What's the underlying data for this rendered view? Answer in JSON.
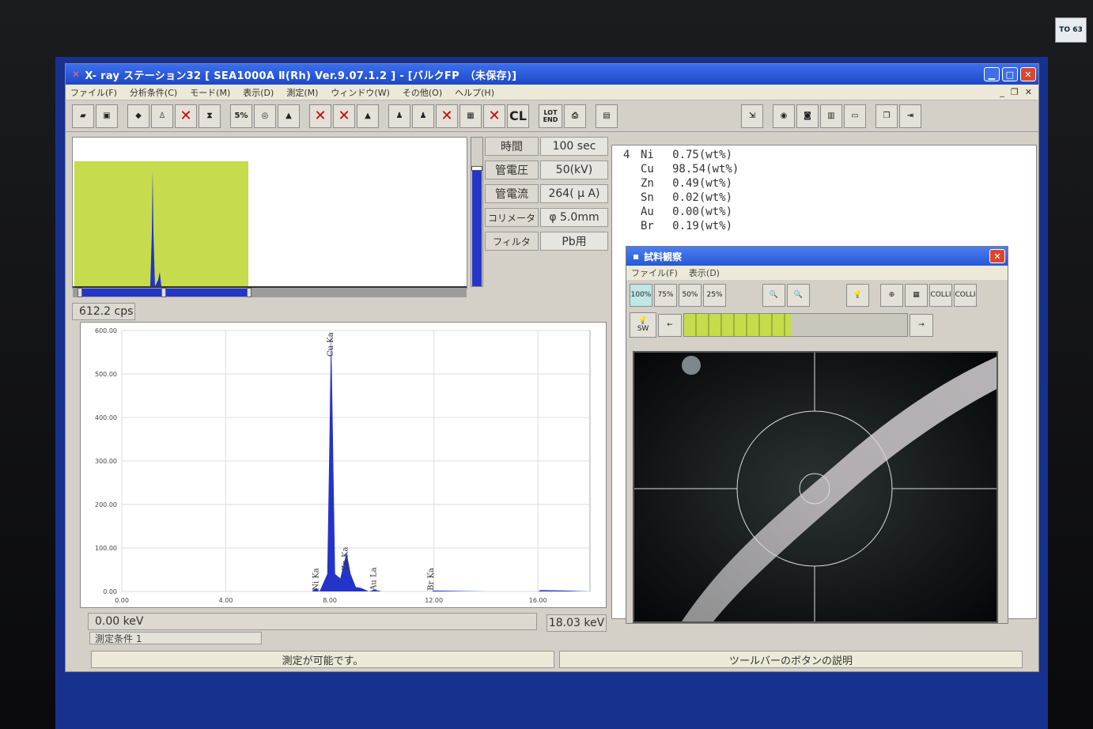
{
  "window": {
    "title": "X- ray ステーション32 [ SEA1000A Ⅱ(Rh) Ver.9.07.1.2 ] - [バルクFP　（未保存)]",
    "menu": [
      "ファイル(F)",
      "分析条件(C)",
      "モード(M)",
      "表示(D)",
      "測定(M)",
      "ウィンドウ(W)",
      "その他(O)",
      "ヘルプ(H)"
    ]
  },
  "toolbar": {
    "zoom_5": "5%",
    "cl_label": "CL",
    "lot_end_label": "LOT END"
  },
  "params": {
    "rows": [
      {
        "label": "時間",
        "value": "100 sec"
      },
      {
        "label": "管電圧",
        "value": "50(kV)"
      },
      {
        "label": "管電流",
        "value": "264( μ A)"
      },
      {
        "label": "コリメータ",
        "value": "φ 5.0mm"
      },
      {
        "label": "フィルタ",
        "value": "Pb用"
      }
    ]
  },
  "cps_readout": "612.2 cps",
  "spectrum": {
    "yticks": [
      "600.00",
      "500.00",
      "400.00",
      "300.00",
      "200.00",
      "100.00",
      "0.00"
    ],
    "xticks": [
      "0.00",
      "4.00",
      "8.00",
      "12.00",
      "16.00"
    ],
    "peak_labels": [
      "Cu Ka",
      "Ni Ka",
      "Zn Ka",
      "Au La",
      "Br Ka"
    ],
    "left_readout": "0.00 keV",
    "right_readout": "18.03 keV",
    "chart_data": {
      "type": "area",
      "x": [
        0,
        2,
        4,
        6,
        7.3,
        7.48,
        7.6,
        7.9,
        8.05,
        8.2,
        8.4,
        8.64,
        8.8,
        9.0,
        9.2,
        9.5,
        9.7,
        10,
        11.9,
        12,
        14,
        16,
        16.1,
        17,
        18
      ],
      "y": [
        0,
        0,
        0,
        0,
        0,
        8,
        0,
        40,
        600,
        40,
        30,
        90,
        40,
        10,
        8,
        0,
        4,
        0,
        0,
        2,
        0,
        0,
        3,
        2,
        0
      ],
      "xlim": [
        0,
        18
      ],
      "ylim": [
        0,
        600
      ],
      "grid": true
    }
  },
  "tabs": {
    "condition": "測定条件 1"
  },
  "status": {
    "left": "測定が可能です。",
    "right": "ツールバーのボタンの説明"
  },
  "results": {
    "prefix": "4",
    "rows": [
      {
        "el": "Ni",
        "val": "0.75(wt%)"
      },
      {
        "el": "Cu",
        "val": "98.54(wt%)"
      },
      {
        "el": "Zn",
        "val": "0.49(wt%)"
      },
      {
        "el": "Sn",
        "val": "0.02(wt%)"
      },
      {
        "el": "Au",
        "val": "0.00(wt%)"
      },
      {
        "el": "Br",
        "val": "0.19(wt%)"
      }
    ]
  },
  "sample_view": {
    "title": "試料観察",
    "menu": [
      "ファイル(F)",
      "表示(D)"
    ],
    "zoom_buttons": [
      "100%",
      "75%",
      "50%",
      "25%"
    ],
    "coll_label": "COLLI",
    "sw_label": "SW",
    "slider_level": 0.48
  },
  "sticker": "TO 63"
}
